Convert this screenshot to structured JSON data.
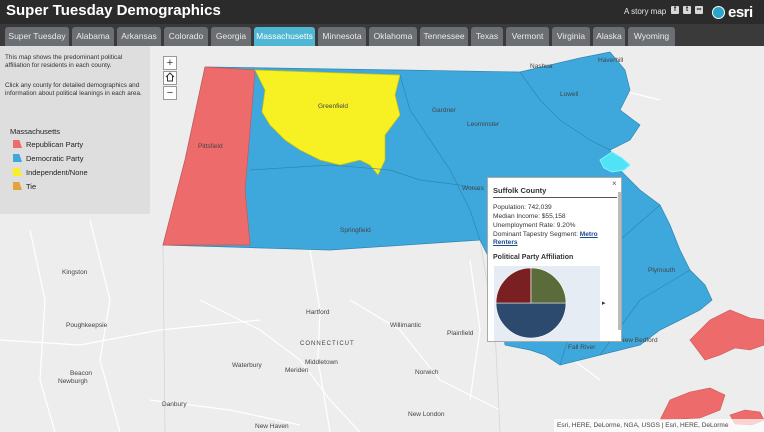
{
  "header": {
    "title": "Super Tuesday Demographics",
    "story_link": "A story map",
    "social": [
      {
        "icon": "facebook-icon",
        "glyph": "f"
      },
      {
        "icon": "twitter-icon",
        "glyph": "t"
      },
      {
        "icon": "link-icon",
        "glyph": "∞"
      }
    ],
    "logo_text": "esri"
  },
  "tabs": [
    {
      "label": "Super Tuesday",
      "active": false
    },
    {
      "label": "Alabama",
      "active": false
    },
    {
      "label": "Arkansas",
      "active": false
    },
    {
      "label": "Colorado",
      "active": false
    },
    {
      "label": "Georgia",
      "active": false
    },
    {
      "label": "Massachusetts",
      "active": true
    },
    {
      "label": "Minnesota",
      "active": false
    },
    {
      "label": "Oklahoma",
      "active": false
    },
    {
      "label": "Tennessee",
      "active": false
    },
    {
      "label": "Texas",
      "active": false
    },
    {
      "label": "Vermont",
      "active": false
    },
    {
      "label": "Virginia",
      "active": false
    },
    {
      "label": "Alaska",
      "active": false
    },
    {
      "label": "Wyoming",
      "active": false
    }
  ],
  "panel": {
    "intro_1": "This map shows the predominant political affiliation for residents in each county.",
    "intro_2": "Click any county for detailed demographics and information about political leanings in each area.",
    "legend_title": "Massachusetts",
    "legend": [
      {
        "label": "Republican Party",
        "color": "#ee6b6b"
      },
      {
        "label": "Democratic Party",
        "color": "#3ea8dc"
      },
      {
        "label": "Independent/None",
        "color": "#f7f022"
      },
      {
        "label": "Tie",
        "color": "#e3a53b"
      }
    ]
  },
  "zoom": {
    "in": "+",
    "home_icon": "home-icon",
    "out": "−"
  },
  "map_labels": {
    "greenfield": "Greenfield",
    "pittsfield": "Pittsfield",
    "springfield": "Springfield",
    "worcester": "Worces",
    "leominster": "Leominster",
    "gardner": "Gardner",
    "nashua": "Nashua",
    "haverhill": "Haverhill",
    "lowell": "Lowell",
    "hartford": "Hartford",
    "waterbury": "Waterbury",
    "meriden": "Meriden",
    "middletown": "Middletown",
    "new_haven": "New Haven",
    "new_london": "New London",
    "norwich": "Norwich",
    "danbury": "Danbury",
    "kingston": "Kingston",
    "poughkeepsie": "Poughkeepsie",
    "beacon": "Beacon",
    "newburgh": "Newburgh",
    "willimantic": "Willimantic",
    "plainfield": "Plainfield",
    "connecticut": "CONNECTICUT",
    "fall_river": "Fall River",
    "plymouth": "Plymouth",
    "new_bedford": "New Bedford"
  },
  "popup": {
    "title": "Suffolk County",
    "close": "×",
    "population_label": "Population:",
    "population": "742,039",
    "income_label": "Median Income:",
    "income": "$55,158",
    "unemployment_label": "Unemployment Rate:",
    "unemployment": "9.20%",
    "tapestry_label": "Dominant Tapestry Segment:",
    "tapestry_1": "Metro",
    "tapestry_2": "Renters",
    "section_title": "Political Party Affiliation",
    "next": "▸",
    "pie": [
      {
        "color": "#2c4a6e",
        "value": 0.5
      },
      {
        "color": "#7a1f22",
        "value": 0.25
      },
      {
        "color": "#5b6b3a",
        "value": 0.25
      }
    ]
  },
  "attribution": "Esri, HERE, DeLorme, NGA, USGS | Esri, HERE, DeLorme"
}
